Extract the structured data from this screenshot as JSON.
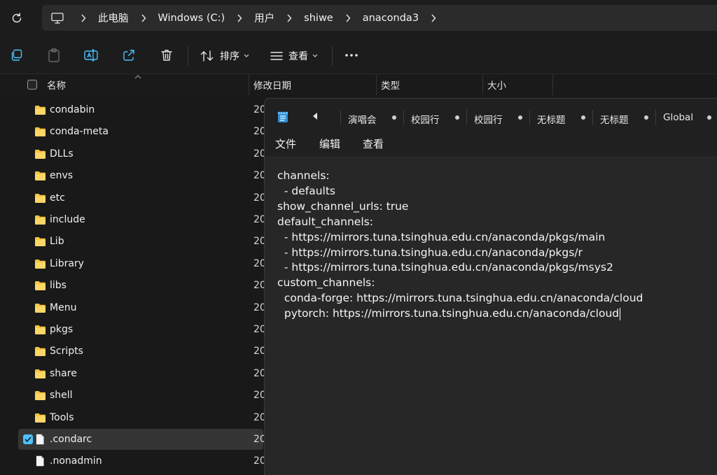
{
  "explorer": {
    "breadcrumbs": [
      "此电脑",
      "Windows (C:)",
      "用户",
      "shiwe",
      "anaconda3"
    ],
    "toolbar": {
      "sort_label": "排序",
      "view_label": "查看"
    },
    "columns": {
      "name": "名称",
      "modified": "修改日期",
      "type": "类型",
      "size": "大小"
    },
    "files": [
      {
        "name": "condabin",
        "date_prefix": "20",
        "kind": "folder"
      },
      {
        "name": "conda-meta",
        "date_prefix": "20",
        "kind": "folder"
      },
      {
        "name": "DLLs",
        "date_prefix": "20",
        "kind": "folder"
      },
      {
        "name": "envs",
        "date_prefix": "20",
        "kind": "folder"
      },
      {
        "name": "etc",
        "date_prefix": "20",
        "kind": "folder"
      },
      {
        "name": "include",
        "date_prefix": "20",
        "kind": "folder"
      },
      {
        "name": "Lib",
        "date_prefix": "20",
        "kind": "folder"
      },
      {
        "name": "Library",
        "date_prefix": "20",
        "kind": "folder"
      },
      {
        "name": "libs",
        "date_prefix": "20",
        "kind": "folder"
      },
      {
        "name": "Menu",
        "date_prefix": "20",
        "kind": "folder"
      },
      {
        "name": "pkgs",
        "date_prefix": "20",
        "kind": "folder"
      },
      {
        "name": "Scripts",
        "date_prefix": "20",
        "kind": "folder"
      },
      {
        "name": "share",
        "date_prefix": "20",
        "kind": "folder"
      },
      {
        "name": "shell",
        "date_prefix": "20",
        "kind": "folder"
      },
      {
        "name": "Tools",
        "date_prefix": "20",
        "kind": "folder"
      },
      {
        "name": ".condarc",
        "date_prefix": "20",
        "kind": "file",
        "selected": true
      },
      {
        "name": ".nonadmin",
        "date_prefix": "20",
        "kind": "file"
      }
    ]
  },
  "notepad": {
    "tabs": [
      "演唱会",
      "校园行",
      "校园行",
      "无标题",
      "无标题",
      "Global"
    ],
    "menu": {
      "file": "文件",
      "edit": "编辑",
      "view": "查看"
    },
    "lines": [
      "channels:",
      "  - defaults",
      "show_channel_urls: true",
      "default_channels:",
      "  - https://mirrors.tuna.tsinghua.edu.cn/anaconda/pkgs/main",
      "  - https://mirrors.tuna.tsinghua.edu.cn/anaconda/pkgs/r",
      "  - https://mirrors.tuna.tsinghua.edu.cn/anaconda/pkgs/msys2",
      "custom_channels:",
      "  conda-forge: https://mirrors.tuna.tsinghua.edu.cn/anaconda/cloud",
      "  pytorch: https://mirrors.tuna.tsinghua.edu.cn/anaconda/cloud"
    ]
  },
  "colors": {
    "accent": "#4cc2ff",
    "folder": "#f5c542"
  }
}
